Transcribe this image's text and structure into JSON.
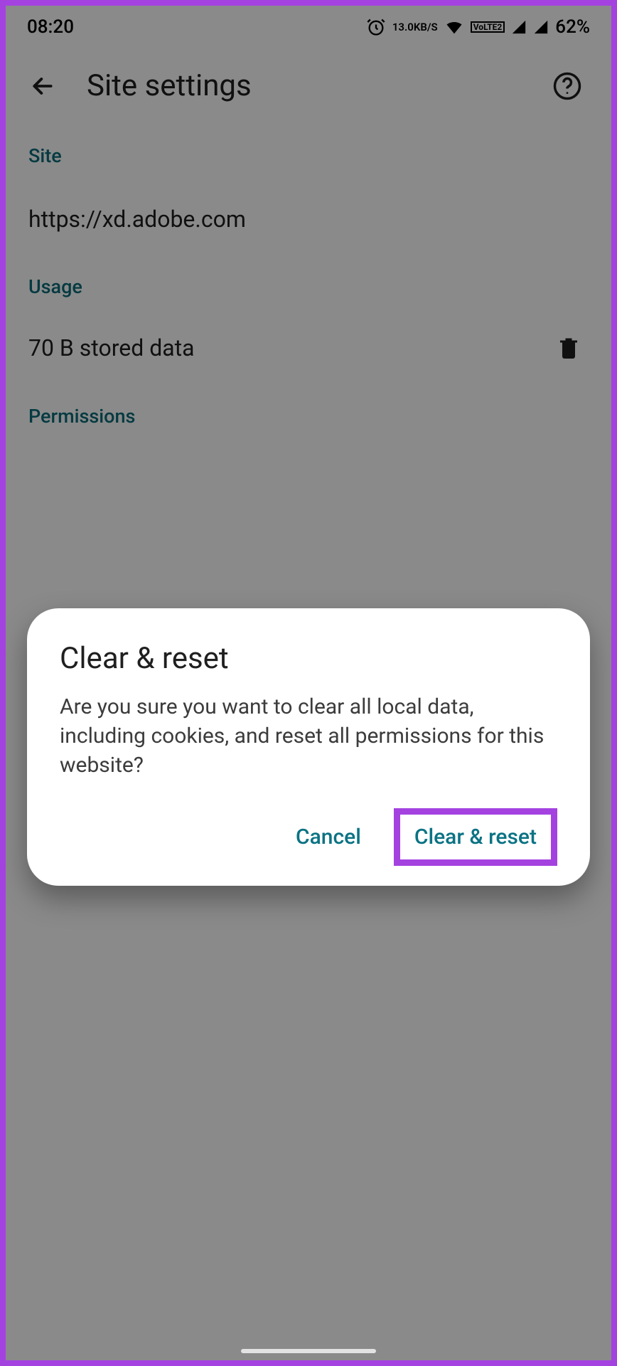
{
  "status": {
    "time": "08:20",
    "kbps_top": "13.0",
    "kbps_bottom": "KB/S",
    "volte_top": "Vo",
    "volte_bottom": "LTE2",
    "battery": "62%"
  },
  "header": {
    "title": "Site settings"
  },
  "sections": {
    "site_label": "Site",
    "site_url": "https://xd.adobe.com",
    "usage_label": "Usage",
    "usage_text": "70 B stored data",
    "permissions_label": "Permissions"
  },
  "dialog": {
    "title": "Clear & reset",
    "message": "Are you sure you want to clear all local data, including cookies, and reset all permissions for this website?",
    "cancel": "Cancel",
    "confirm": "Clear & reset"
  }
}
